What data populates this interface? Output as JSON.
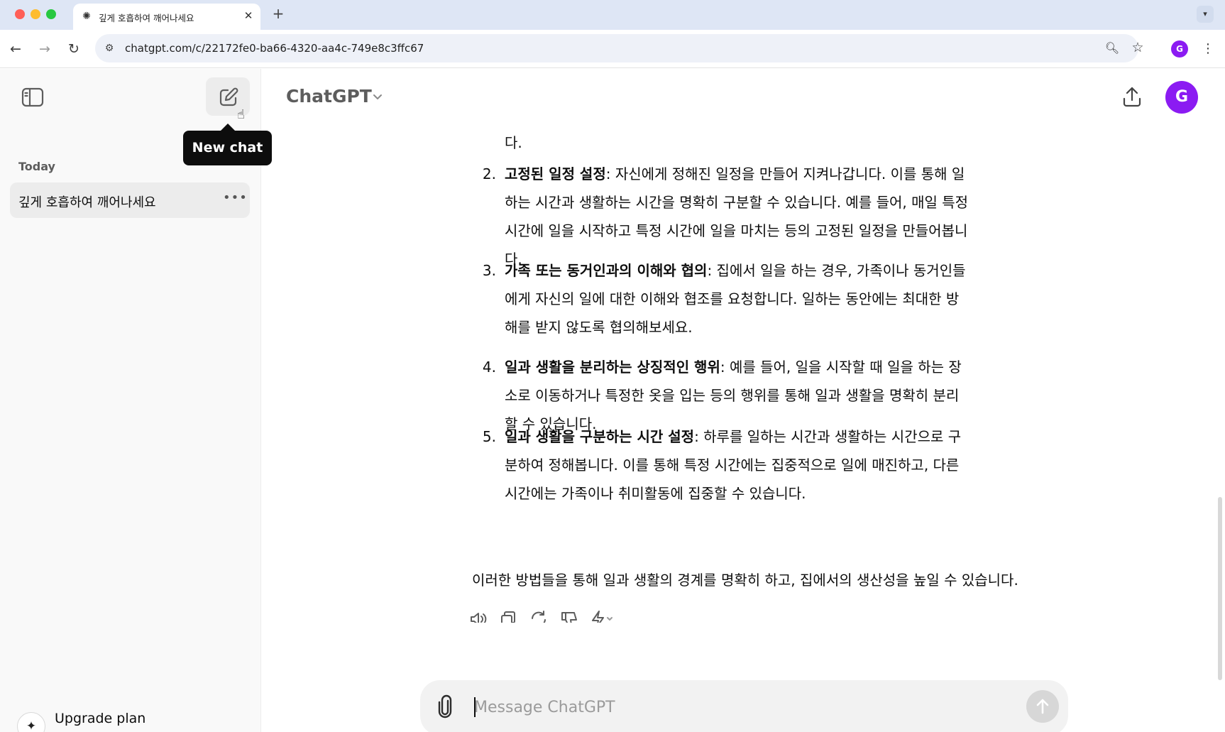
{
  "browser": {
    "tab_title": "깊게 호흡하여 깨어나세요",
    "tab_close": "✕",
    "new_tab": "+",
    "url": "chatgpt.com/c/22172fe0-ba66-4320-aa4c-749e8c3ffc67",
    "profile_initial": "G"
  },
  "sidebar": {
    "tooltip": "New chat",
    "section_label": "Today",
    "history": [
      {
        "label": "깊게 호흡하여 깨어나세요",
        "more": "•••"
      }
    ],
    "upgrade_label": "Upgrade plan"
  },
  "header": {
    "model_name": "ChatGPT",
    "avatar_initial": "G"
  },
  "conversation": {
    "para_tail": "다.",
    "list": [
      {
        "num": "2.",
        "title": "고정된 일정 설정",
        "text": ": 자신에게 정해진 일정을 만들어 지켜나갑니다. 이를 통해 일하는 시간과 생활하는 시간을 명확히 구분할 수 있습니다. 예를 들어, 매일 특정 시간에 일을 시작하고 특정 시간에 일을 마치는 등의 고정된 일정을 만들어봅니다."
      },
      {
        "num": "3.",
        "title": "가족 또는 동거인과의 이해와 협의",
        "text": ": 집에서 일을 하는 경우, 가족이나 동거인들에게 자신의 일에 대한 이해와 협조를 요청합니다. 일하는 동안에는 최대한 방해를 받지 않도록 협의해보세요."
      },
      {
        "num": "4.",
        "title": "일과 생활을 분리하는 상징적인 행위",
        "text": ": 예를 들어, 일을 시작할 때 일을 하는 장소로 이동하거나 특정한 옷을 입는 등의 행위를 통해 일과 생활을 명확히 분리할 수 있습니다."
      },
      {
        "num": "5.",
        "title": "일과 생활을 구분하는 시간 설정",
        "text": ": 하루를 일하는 시간과 생활하는 시간으로 구분하여 정해봅니다. 이를 통해 특정 시간에는 집중적으로 일에 매진하고, 다른 시간에는 가족이나 취미활동에 집중할 수 있습니다."
      }
    ],
    "closing": "이러한 방법들을 통해 일과 생활의 경계를 명확히 하고, 집에서의 생산성을 높일 수 있습니다."
  },
  "composer": {
    "placeholder": "Message ChatGPT",
    "value": ""
  },
  "colors": {
    "accent_purple": "#8b1bf2",
    "sidebar_bg": "#f9f9f9",
    "tabbar_bg": "#dee6f5"
  },
  "icons": {
    "sidebar_toggle": "sidebar-toggle-icon",
    "new_chat": "pencil-square-icon",
    "share": "share-upload-icon",
    "read_aloud": "speaker-icon",
    "copy": "copy-icon",
    "regenerate": "refresh-icon",
    "dislike": "thumbs-down-icon",
    "model_switch": "lightning-icon",
    "attach": "paperclip-icon",
    "send": "arrow-up-icon"
  }
}
